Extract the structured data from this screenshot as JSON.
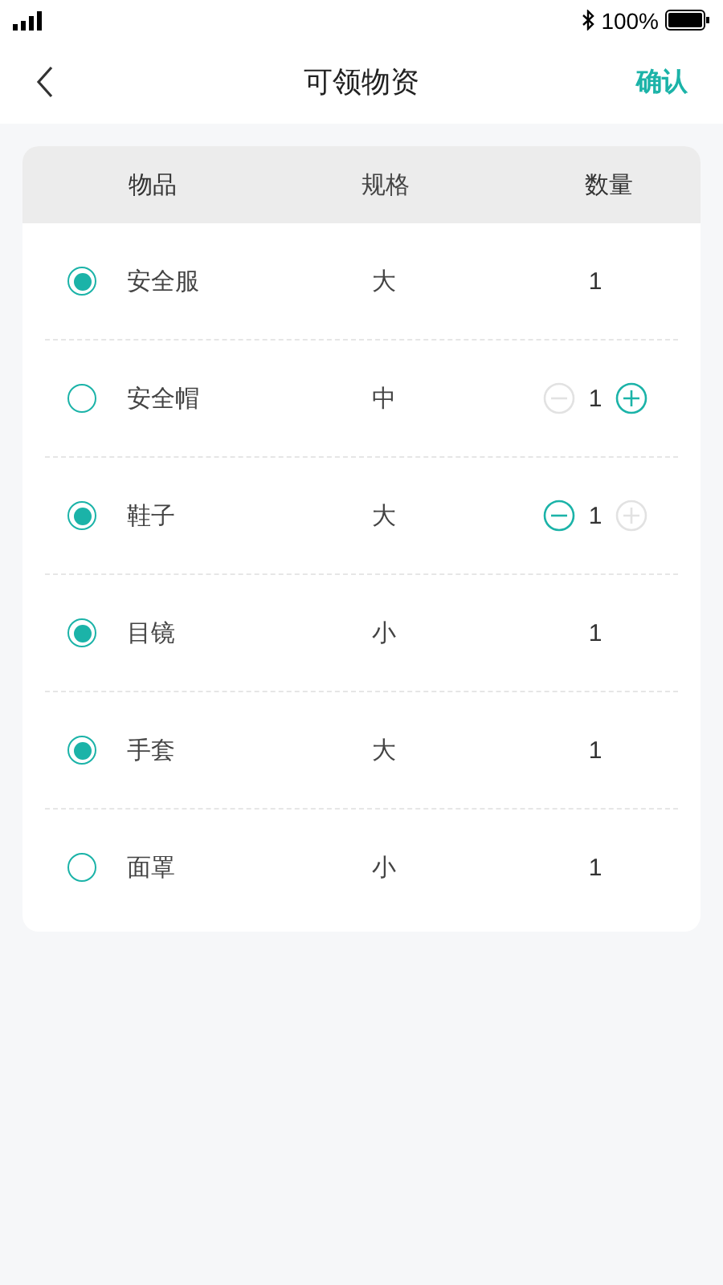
{
  "status_bar": {
    "battery": "100%"
  },
  "nav": {
    "title": "可领物资",
    "action": "确认"
  },
  "table": {
    "columns": [
      "物品",
      "规格",
      "数量"
    ],
    "rows": [
      {
        "selected": true,
        "name": "安全服",
        "spec": "大",
        "kind": "fixed",
        "quantity": "1"
      },
      {
        "selected": false,
        "name": "安全帽",
        "spec": "中",
        "kind": "stepper",
        "quantity": "1",
        "minus_enabled": false,
        "plus_enabled": true
      },
      {
        "selected": true,
        "name": "鞋子",
        "spec": "大",
        "kind": "stepper",
        "quantity": "1",
        "minus_enabled": true,
        "plus_enabled": false
      },
      {
        "selected": true,
        "name": "目镜",
        "spec": "小",
        "kind": "fixed",
        "quantity": "1"
      },
      {
        "selected": true,
        "name": "手套",
        "spec": "大",
        "kind": "fixed",
        "quantity": "1"
      },
      {
        "selected": false,
        "name": "面罩",
        "spec": "小",
        "kind": "fixed",
        "quantity": "1"
      }
    ]
  }
}
